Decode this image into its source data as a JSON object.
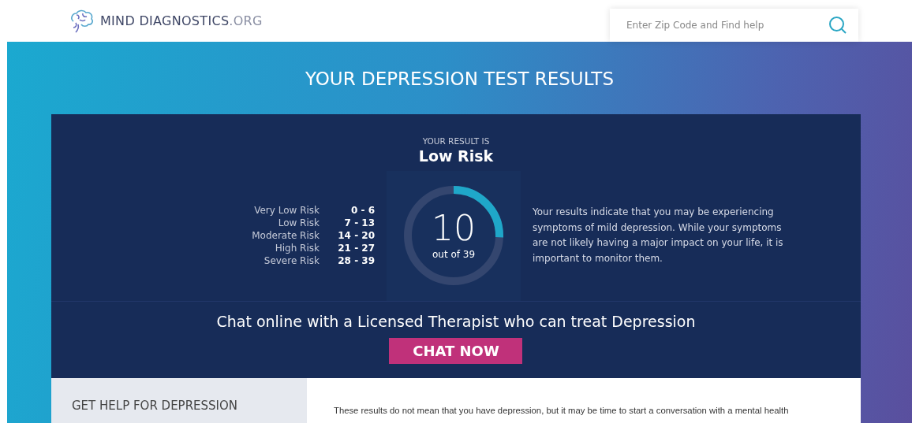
{
  "header": {
    "logo_text": "MIND DIAGNOSTICS",
    "logo_suffix": ".ORG",
    "search": {
      "placeholder": "Enter Zip Code and Find help"
    }
  },
  "hero": {
    "title": "YOUR DEPRESSION TEST RESULTS"
  },
  "result": {
    "caption": "YOUR RESULT IS",
    "value": "Low Risk",
    "ranges": [
      {
        "label": "Very Low Risk",
        "range": "0 - 6"
      },
      {
        "label": "Low Risk",
        "range": "7 - 13"
      },
      {
        "label": "Moderate Risk",
        "range": "14 - 20"
      },
      {
        "label": "High Risk",
        "range": "21 - 27"
      },
      {
        "label": "Severe Risk",
        "range": "28 - 39"
      }
    ],
    "gauge": {
      "score": "10",
      "out_of": "out of 39",
      "level": 0.256
    },
    "description": "Your results indicate that you may be experiencing symptoms of mild depression. While your symptoms are not likely having a major impact on your life, it is important to monitor them."
  },
  "chat": {
    "text": "Chat online with a Licensed Therapist who can treat Depression",
    "button": "CHAT NOW"
  },
  "help": {
    "heading": "GET HELP FOR DEPRESSION",
    "text": "These results do not mean that you have depression, but it may be time to start a conversation with a mental health"
  }
}
